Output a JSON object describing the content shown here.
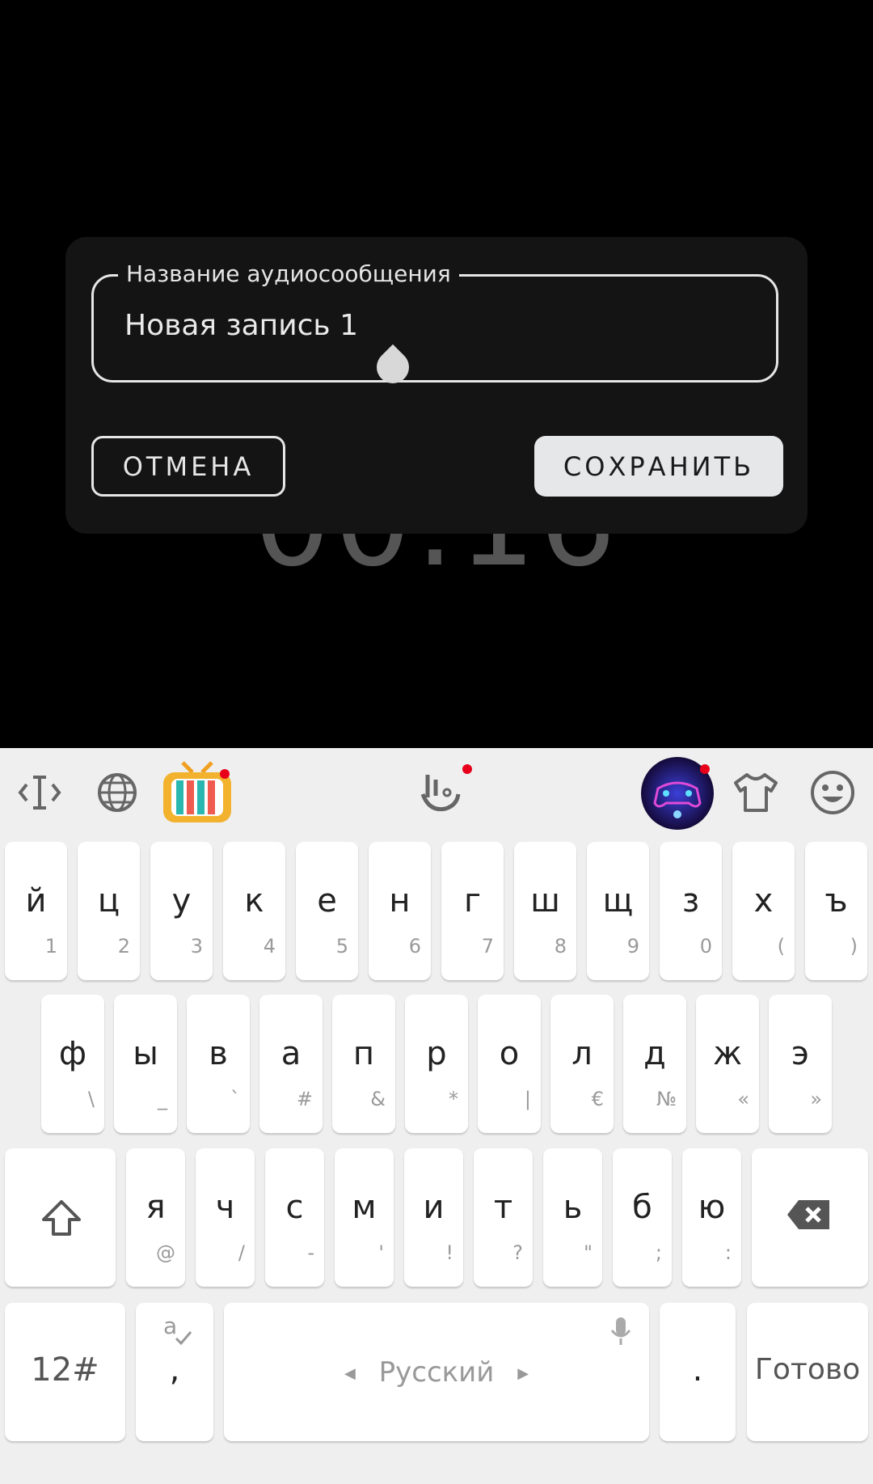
{
  "background": {
    "timer_text": "00:16"
  },
  "dialog": {
    "field_label": "Название аудиосообщения",
    "field_value": "Новая запись 1",
    "cancel_label": "ОТМЕНА",
    "save_label": "СОХРАНИТЬ"
  },
  "keyboard": {
    "toolbar": {
      "icons": [
        "cursor-move-icon",
        "globe-icon",
        "tv-theme-icon",
        "gesture-icon",
        "game-icon",
        "shirt-icon",
        "emoji-icon"
      ]
    },
    "row1": [
      {
        "k": "й",
        "s": "1"
      },
      {
        "k": "ц",
        "s": "2"
      },
      {
        "k": "у",
        "s": "3"
      },
      {
        "k": "к",
        "s": "4"
      },
      {
        "k": "е",
        "s": "5"
      },
      {
        "k": "н",
        "s": "6"
      },
      {
        "k": "г",
        "s": "7"
      },
      {
        "k": "ш",
        "s": "8"
      },
      {
        "k": "щ",
        "s": "9"
      },
      {
        "k": "з",
        "s": "0"
      },
      {
        "k": "х",
        "s": "("
      },
      {
        "k": "ъ",
        "s": ")"
      }
    ],
    "row2": [
      {
        "k": "ф",
        "s": "\\"
      },
      {
        "k": "ы",
        "s": "_"
      },
      {
        "k": "в",
        "s": "`"
      },
      {
        "k": "а",
        "s": "#"
      },
      {
        "k": "п",
        "s": "&"
      },
      {
        "k": "р",
        "s": "*"
      },
      {
        "k": "о",
        "s": "|"
      },
      {
        "k": "л",
        "s": "€"
      },
      {
        "k": "д",
        "s": "№"
      },
      {
        "k": "ж",
        "s": "«"
      },
      {
        "k": "э",
        "s": "»"
      }
    ],
    "row3": [
      {
        "k": "я",
        "s": "@"
      },
      {
        "k": "ч",
        "s": "/"
      },
      {
        "k": "с",
        "s": "-"
      },
      {
        "k": "м",
        "s": "'"
      },
      {
        "k": "и",
        "s": "!"
      },
      {
        "k": "т",
        "s": "?"
      },
      {
        "k": "ь",
        "s": "\""
      },
      {
        "k": "б",
        "s": ";"
      },
      {
        "k": "ю",
        "s": ":"
      }
    ],
    "bottom": {
      "numbers_label": "12#",
      "comma_label": ",",
      "space_label": "Русский",
      "period_label": ".",
      "done_label": "Готово"
    }
  }
}
